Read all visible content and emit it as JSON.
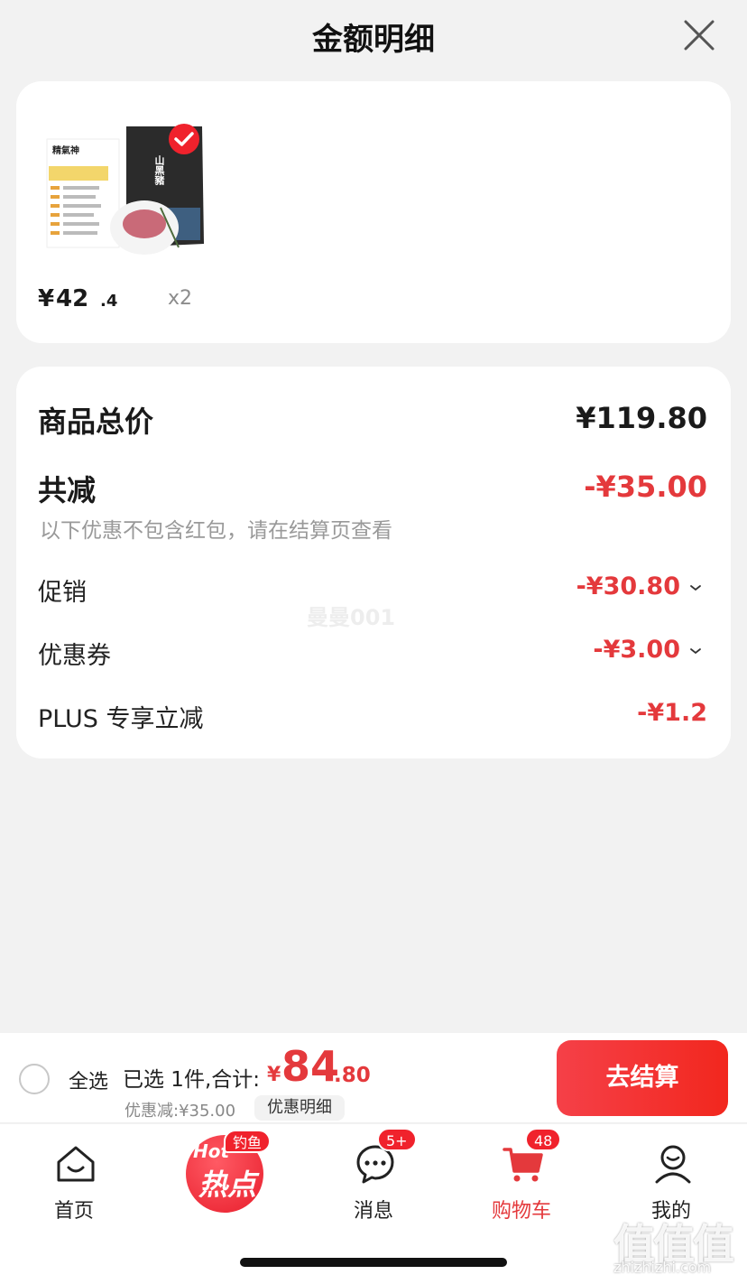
{
  "header": {
    "title": "金额明细"
  },
  "product": {
    "price_symbol": "¥",
    "price_int": "42",
    "price_dec": ".4",
    "quantity": "x2",
    "brand_text": "精氣神",
    "sub_text": "山黑豬"
  },
  "summary": {
    "total_label": "商品总价",
    "total_value": "¥119.80",
    "reduce_label": "共减",
    "reduce_value": "-¥35.00",
    "note": "以下优惠不包含红包，请在结算页查看",
    "promo_label": "促销",
    "promo_value": "-¥30.80",
    "coupon_label": "优惠券",
    "coupon_value": "-¥3.00",
    "plus_label": "PLUS 专享立减",
    "plus_value": "-¥1.2"
  },
  "watermark": "曼曼001",
  "bottom_bar": {
    "select_all": "全选",
    "selected_text": "已选 1件,合计:",
    "total_symbol": "¥",
    "total_int": "84",
    "total_dec": ".80",
    "discount_text": "优惠减:¥35.00",
    "detail_button": "优惠明细",
    "checkout_button": "去结算"
  },
  "tabs": {
    "home": "首页",
    "hot_en": "Hot",
    "hot_cn": "热点",
    "hot_tag": "钓鱼",
    "messages": "消息",
    "messages_badge": "5+",
    "cart": "购物车",
    "cart_badge": "48",
    "mine": "我的"
  },
  "site_watermark": {
    "mark": "值值值",
    "url": "zhizhizhi.com"
  },
  "colors": {
    "accent": "#e4393c",
    "background": "#f2f2f2"
  }
}
